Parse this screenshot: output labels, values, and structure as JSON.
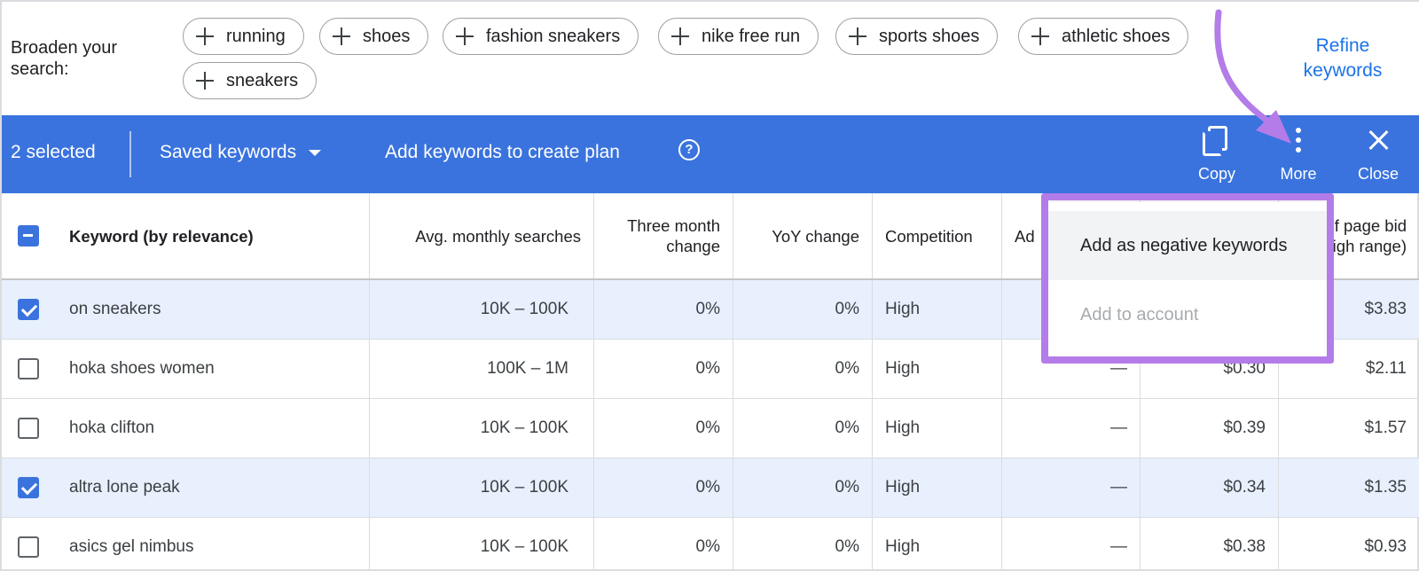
{
  "broaden": {
    "label": "Broaden your search:",
    "chips": [
      "running",
      "shoes",
      "fashion sneakers",
      "nike free run",
      "sports shoes",
      "athletic shoes",
      "sneakers"
    ],
    "refine_label": "Refine keywords"
  },
  "action_bar": {
    "selected_text": "2 selected",
    "saved_keywords_label": "Saved keywords",
    "add_plan_label": "Add keywords to create plan",
    "help_icon": "question-circle-icon",
    "copy_label": "Copy",
    "more_label": "More",
    "close_label": "Close",
    "background_color": "#3a73de"
  },
  "table": {
    "headers": {
      "keyword": "Keyword (by relevance)",
      "avg_monthly": "Avg. monthly searches",
      "three_month": "Three month change",
      "yoy": "YoY change",
      "competition": "Competition",
      "ad_impr": "Ad",
      "top_bid_high": "p of page bid (high range)"
    },
    "rows": [
      {
        "keyword": "on sneakers",
        "avg": "10K – 100K",
        "three_month": "0%",
        "yoy": "0%",
        "competition": "High",
        "ad": "",
        "low_bid": "",
        "high_bid": "$3.83",
        "checked": true
      },
      {
        "keyword": "hoka shoes women",
        "avg": "100K – 1M",
        "three_month": "0%",
        "yoy": "0%",
        "competition": "High",
        "ad": "—",
        "low_bid": "$0.30",
        "high_bid": "$2.11",
        "checked": false
      },
      {
        "keyword": "hoka clifton",
        "avg": "10K – 100K",
        "three_month": "0%",
        "yoy": "0%",
        "competition": "High",
        "ad": "—",
        "low_bid": "$0.39",
        "high_bid": "$1.57",
        "checked": false
      },
      {
        "keyword": "altra lone peak",
        "avg": "10K – 100K",
        "three_month": "0%",
        "yoy": "0%",
        "competition": "High",
        "ad": "—",
        "low_bid": "$0.34",
        "high_bid": "$1.35",
        "checked": true
      },
      {
        "keyword": "asics gel nimbus",
        "avg": "10K – 100K",
        "three_month": "0%",
        "yoy": "0%",
        "competition": "High",
        "ad": "—",
        "low_bid": "$0.38",
        "high_bid": "$0.93",
        "checked": false
      }
    ]
  },
  "more_menu": {
    "items": [
      "Add as negative keywords",
      "Add to account"
    ],
    "highlight_color": "#b47ce8"
  }
}
